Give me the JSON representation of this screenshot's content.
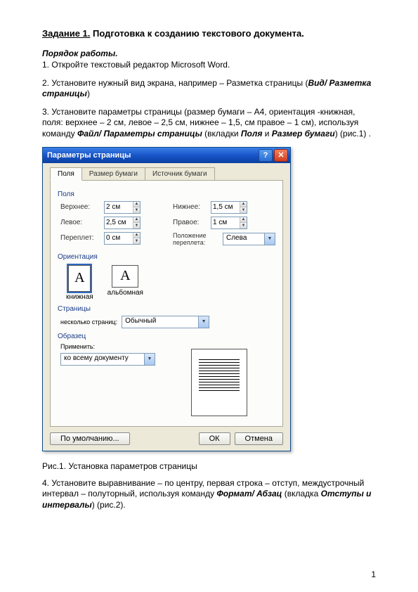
{
  "task": {
    "label": "Задание 1.",
    "title": "Подготовка к созданию текстового документа."
  },
  "work_order": "Порядок работы.",
  "step1": "1. Откройте текстовый редактор Microsoft Word.",
  "step2_a": "2. Установите нужный вид экрана, например – Разметка страницы (",
  "step2_b": "Вид/ Разметка страницы",
  "step2_c": ")",
  "step3_a": "3. Установите параметры страницы (размер бумаги – А4, ориентация -книжная, поля: верхнее – 2 см, левое – 2,5 см, нижнее – 1,5, см правое – 1 см), используя команду ",
  "step3_b": "Файл/ Параметры страницы",
  "step3_c": " (вкладки ",
  "step3_d": "Поля",
  "step3_e": " и ",
  "step3_f": "Размер бумаги",
  "step3_g": ") (рис.1) .",
  "dialog": {
    "title": "Параметры страницы",
    "tabs": [
      "Поля",
      "Размер бумаги",
      "Источник бумаги"
    ],
    "fields_label": "Поля",
    "top_label": "Верхнее:",
    "top_value": "2 см",
    "bottom_label": "Нижнее:",
    "bottom_value": "1,5 см",
    "left_label": "Левое:",
    "left_value": "2,5 см",
    "right_label": "Правое:",
    "right_value": "1 см",
    "gutter_label": "Переплет:",
    "gutter_value": "0 см",
    "gutter_pos_label": "Положение переплета:",
    "gutter_pos_value": "Слева",
    "orientation_label": "Ориентация",
    "portrait": "книжная",
    "landscape": "альбомная",
    "pages_label": "Страницы",
    "several_pages_label": "несколько страниц:",
    "several_pages_value": "Обычный",
    "preview_label": "Образец",
    "apply_to_label": "Применить:",
    "apply_to_value": "ко всему документу",
    "default_btn": "По умолчанию...",
    "ok_btn": "ОК",
    "cancel_btn": "Отмена"
  },
  "figure_caption": "Рис.1. Установка параметров страницы",
  "step4_a": "4. Установите выравнивание – по центру, первая строка – отступ, междустрочный интервал – полуторный, используя команду ",
  "step4_b": "Формат/ Абзац",
  "step4_c": " (вкладка ",
  "step4_d": "Отступы и интервалы",
  "step4_e": ") (рис.2).",
  "page_number": "1"
}
